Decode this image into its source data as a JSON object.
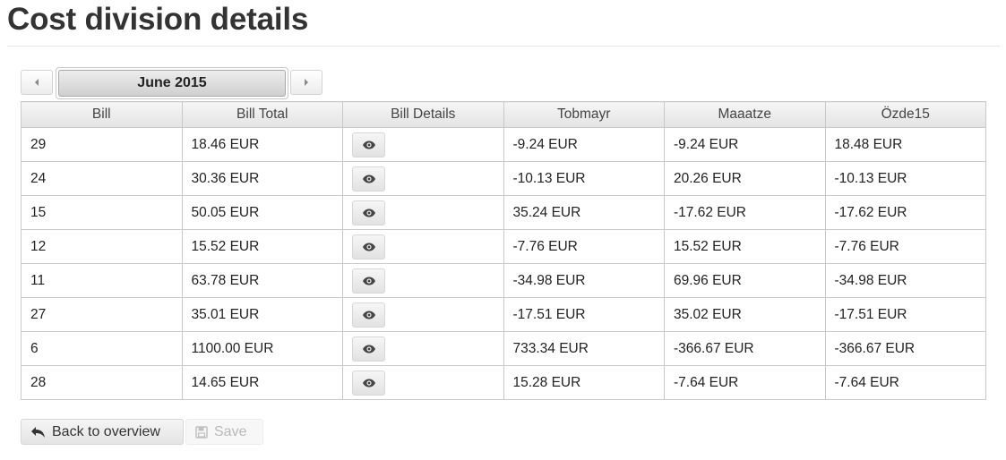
{
  "page": {
    "title": "Cost division details"
  },
  "month_nav": {
    "prev_icon": "caret-left-icon",
    "next_icon": "caret-right-icon",
    "current_month": "June 2015"
  },
  "table": {
    "columns": [
      "Bill",
      "Bill Total",
      "Bill Details",
      "Tobmayr",
      "Maaatze",
      "Özde15"
    ],
    "detail_icon": "eye-icon",
    "rows": [
      {
        "bill": "29",
        "total": "18.46 EUR",
        "p1": "-9.24 EUR",
        "p2": "-9.24 EUR",
        "p3": "18.48 EUR"
      },
      {
        "bill": "24",
        "total": "30.36 EUR",
        "p1": "-10.13 EUR",
        "p2": "20.26 EUR",
        "p3": "-10.13 EUR"
      },
      {
        "bill": "15",
        "total": "50.05 EUR",
        "p1": "35.24 EUR",
        "p2": "-17.62 EUR",
        "p3": "-17.62 EUR"
      },
      {
        "bill": "12",
        "total": "15.52 EUR",
        "p1": "-7.76 EUR",
        "p2": "15.52 EUR",
        "p3": "-7.76 EUR"
      },
      {
        "bill": "11",
        "total": "63.78 EUR",
        "p1": "-34.98 EUR",
        "p2": "69.96 EUR",
        "p3": "-34.98 EUR"
      },
      {
        "bill": "27",
        "total": "35.01 EUR",
        "p1": "-17.51 EUR",
        "p2": "35.02 EUR",
        "p3": "-17.51 EUR"
      },
      {
        "bill": "6",
        "total": "1100.00 EUR",
        "p1": "733.34 EUR",
        "p2": "-366.67 EUR",
        "p3": "-366.67 EUR"
      },
      {
        "bill": "28",
        "total": "14.65 EUR",
        "p1": "15.28 EUR",
        "p2": "-7.64 EUR",
        "p3": "-7.64 EUR"
      }
    ]
  },
  "actions": {
    "back_label": "Back to overview",
    "back_icon": "reply-arrow-icon",
    "save_label": "Save",
    "save_icon": "floppy-disk-icon",
    "save_disabled": true
  }
}
